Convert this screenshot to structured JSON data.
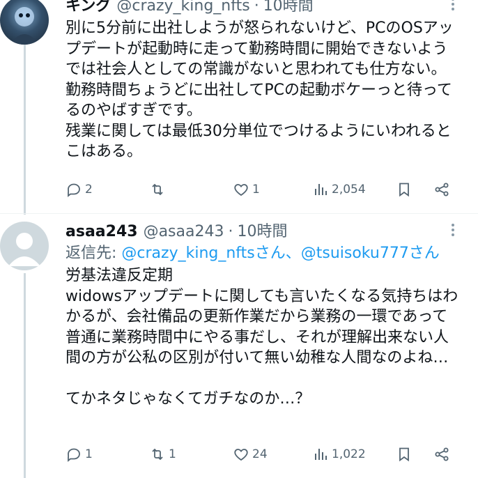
{
  "post1": {
    "name": "キング",
    "handle": "@crazy_king_nfts",
    "dot": "·",
    "time": "10時間",
    "body": "別に5分前に出社しようが怒られないけど、PCのOSアップデートが起動時に走って勤務時間に開始できないようでは社会人としての常識がないと思われても仕方ない。\n勤務時間ちょうどに出社してPCの起動ボケーっと待ってるのやばすぎです。\n残業に関しては最低30分単位でつけるようにいわれるとこはある。",
    "replies": "2",
    "retweets": "",
    "likes": "1",
    "views": "2,054"
  },
  "post2": {
    "name": "asaa243",
    "handle": "@asaa243",
    "dot": "·",
    "time": "10時間",
    "reply_prefix": "返信先: ",
    "reply_mentions": "@crazy_king_nftsさん、@tsuisoku777さん",
    "body": "労基法違反定期\nwidowsアップデートに関しても言いたくなる気持ちはわかるが、会社備品の更新作業だから業務の一環であって普通に業務時間中にやる事だし、それが理解出来ない人間の方が公私の区別が付いて無い幼稚な人間なのよね…\n\nてかネタじゃなくてガチなのか…？",
    "replies": "1",
    "retweets": "1",
    "likes": "24",
    "views": "1,022"
  },
  "icons": {
    "more": "more-vertical-icon",
    "reply": "reply-icon",
    "retweet": "retweet-icon",
    "like": "heart-icon",
    "views": "views-icon",
    "bookmark": "bookmark-icon",
    "share": "share-icon"
  },
  "colors": {
    "text": "#0f1419",
    "muted": "#536471",
    "link": "#1d9bf0"
  }
}
